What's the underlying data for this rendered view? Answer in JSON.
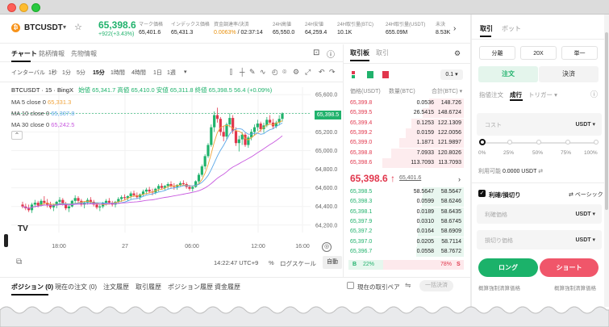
{
  "ticker": {
    "coin_icon": "bitcoin-icon",
    "symbol": "BTCUSDT",
    "price": "65,398.6",
    "change": "+922(+3.43%)",
    "stats": [
      {
        "label": "マーク価格",
        "value": "65,401.6",
        "orange": false
      },
      {
        "label": "インデックス価格",
        "value": "65,431.3",
        "orange": false
      },
      {
        "label": "資金調達率/決済",
        "value": "0.0063%",
        "value2": " / 02:37:14",
        "orange": true
      },
      {
        "label": "24H高値",
        "value": "65,550.0",
        "orange": false
      },
      {
        "label": "24H安値",
        "value": "64,259.4",
        "orange": false
      },
      {
        "label": "24H取引量(BTC)",
        "value": "10.1K",
        "orange": false
      },
      {
        "label": "24H取引量(USDT)",
        "value": "655.09M",
        "orange": false
      },
      {
        "label": "未決",
        "value": "8.53K",
        "orange": false
      }
    ]
  },
  "chart_tabs": [
    "チャート",
    "銘柄情報",
    "先物情報"
  ],
  "chart_toolbar": {
    "intervals": [
      "インターバル",
      "1秒",
      "1分",
      "5分",
      "15分",
      "1時間",
      "4時間",
      "1日",
      "1週"
    ],
    "active_interval": "15分"
  },
  "chart_info": {
    "title": "BTCUSDT · 15 · BingX",
    "ohlc": "始値 65,341.7  高値 65,410.0  安値 65,311.8  終値 65,398.5  56.4 (+0.09%)",
    "ma5_label": "MA 5 close 0",
    "ma5_value": "65,331.3",
    "ma10_label": "MA 10 close 0",
    "ma10_value": "65,307.8",
    "ma30_label": "MA 30 close 0",
    "ma30_value": "65,242.5",
    "last_price_tag": "65,398.5",
    "time_label": "14:22:47 UTC+9",
    "log_scale": "ログスケール",
    "auto": "自動",
    "pct": "%"
  },
  "chart_data": {
    "type": "candlestick",
    "yticks": [
      "65,600.0",
      "65,400.0",
      "65,200.0",
      "65,000.0",
      "64,800.0",
      "64,600.0",
      "64,400.0",
      "64,200.0"
    ],
    "ylim": [
      64120,
      65680
    ],
    "xticks": [
      "18:00",
      "27",
      "06:00",
      "12:00",
      "16:00"
    ],
    "candles": [
      [
        64420,
        64450,
        64380,
        64400
      ],
      [
        64400,
        64430,
        64360,
        64380
      ],
      [
        64380,
        64420,
        64340,
        64360
      ],
      [
        64360,
        64440,
        64330,
        64420
      ],
      [
        64420,
        64470,
        64390,
        64440
      ],
      [
        64440,
        64460,
        64390,
        64410
      ],
      [
        64410,
        64480,
        64400,
        64460
      ],
      [
        64460,
        64510,
        64420,
        64440
      ],
      [
        64440,
        64480,
        64390,
        64420
      ],
      [
        64420,
        64450,
        64370,
        64390
      ],
      [
        64390,
        64430,
        64350,
        64410
      ],
      [
        64410,
        64460,
        64380,
        64450
      ],
      [
        64450,
        64500,
        64420,
        64470
      ],
      [
        64470,
        64490,
        64410,
        64430
      ],
      [
        64430,
        64450,
        64360,
        64380
      ],
      [
        64380,
        64420,
        64340,
        64400
      ],
      [
        64400,
        64470,
        64390,
        64460
      ],
      [
        64460,
        64520,
        64430,
        64490
      ],
      [
        64490,
        64510,
        64440,
        64460
      ],
      [
        64460,
        64480,
        64400,
        64420
      ],
      [
        64420,
        64450,
        64380,
        64440
      ],
      [
        64440,
        64490,
        64420,
        64470
      ],
      [
        64470,
        64500,
        64430,
        64450
      ],
      [
        64450,
        64470,
        64400,
        64420
      ],
      [
        64420,
        64440,
        64370,
        64390
      ],
      [
        64390,
        64420,
        64350,
        64400
      ],
      [
        64400,
        64450,
        64380,
        64440
      ],
      [
        64440,
        64480,
        64410,
        64460
      ],
      [
        64460,
        64490,
        64420,
        64440
      ],
      [
        64440,
        64460,
        64400,
        64420
      ],
      [
        64420,
        64460,
        64390,
        64450
      ],
      [
        64450,
        64500,
        64430,
        64480
      ],
      [
        64480,
        64520,
        64450,
        64500
      ],
      [
        64500,
        64530,
        64470,
        64490
      ],
      [
        64490,
        64520,
        64460,
        64510
      ],
      [
        64510,
        64560,
        64480,
        64540
      ],
      [
        64540,
        64570,
        64500,
        64520
      ],
      [
        64520,
        64550,
        64480,
        64500
      ],
      [
        64500,
        64540,
        64470,
        64530
      ],
      [
        64530,
        64580,
        64510,
        64560
      ],
      [
        64560,
        64600,
        64530,
        64580
      ],
      [
        64580,
        64610,
        64540,
        64560
      ],
      [
        64560,
        64590,
        64520,
        64550
      ],
      [
        64550,
        64600,
        64530,
        64590
      ],
      [
        64590,
        64640,
        64560,
        64620
      ],
      [
        64620,
        64650,
        64580,
        64600
      ],
      [
        64600,
        64630,
        64570,
        64620
      ],
      [
        64620,
        64660,
        64590,
        64640
      ],
      [
        64640,
        64670,
        64600,
        64620
      ],
      [
        64620,
        64650,
        64580,
        64610
      ],
      [
        64610,
        64640,
        64580,
        64630
      ],
      [
        64630,
        64670,
        64610,
        64650
      ],
      [
        64650,
        64680,
        64620,
        64640
      ],
      [
        64640,
        64660,
        64590,
        64610
      ],
      [
        64610,
        64630,
        64570,
        64590
      ],
      [
        64590,
        64620,
        64560,
        64610
      ],
      [
        64610,
        64680,
        64600,
        64670
      ],
      [
        64670,
        64760,
        64650,
        64740
      ],
      [
        64740,
        64850,
        64720,
        64830
      ],
      [
        64830,
        64960,
        64800,
        64940
      ],
      [
        64940,
        65080,
        64920,
        65060
      ],
      [
        65060,
        65280,
        65040,
        65250
      ],
      [
        65250,
        65420,
        65200,
        65380
      ],
      [
        65380,
        65460,
        65300,
        65340
      ],
      [
        65340,
        65360,
        65160,
        65200
      ],
      [
        65200,
        65260,
        65100,
        65150
      ],
      [
        65150,
        65300,
        65120,
        65280
      ],
      [
        65280,
        65400,
        65250,
        65350
      ],
      [
        65350,
        65380,
        65180,
        65210
      ],
      [
        65210,
        65250,
        65050,
        65080
      ],
      [
        65080,
        65160,
        64990,
        65120
      ],
      [
        65120,
        65200,
        65060,
        65170
      ],
      [
        65170,
        65190,
        65040,
        65060
      ],
      [
        65060,
        65160,
        65030,
        65140
      ],
      [
        65140,
        65230,
        65110,
        65200
      ],
      [
        65200,
        65280,
        65160,
        65250
      ],
      [
        65250,
        65330,
        65210,
        65290
      ],
      [
        65290,
        65310,
        65200,
        65230
      ],
      [
        65230,
        65300,
        65190,
        65270
      ],
      [
        65270,
        65360,
        65250,
        65330
      ],
      [
        65330,
        65380,
        65280,
        65300
      ],
      [
        65300,
        65340,
        65230,
        65260
      ],
      [
        65260,
        65320,
        65240,
        65300
      ],
      [
        65300,
        65380,
        65270,
        65340
      ],
      [
        65340,
        65410,
        65310,
        65398
      ]
    ],
    "ma": [
      {
        "name": "MA 5",
        "color": "#f0a33a"
      },
      {
        "name": "MA 10",
        "color": "#5aa7e8"
      },
      {
        "name": "MA 30",
        "color": "#c85adf"
      }
    ]
  },
  "orderbook": {
    "tabs": [
      "取引板",
      "取引"
    ],
    "precision": "0.1",
    "headers": [
      "価格(USDT)",
      "数量(BTC)",
      "合計(BTC)"
    ],
    "asks": [
      [
        "65,399.8",
        "0.0536",
        "148.726",
        0.3
      ],
      [
        "65,399.5",
        "26.5415",
        "148.6724",
        0.35
      ],
      [
        "65,399.4",
        "0.1253",
        "122.1309",
        0.45
      ],
      [
        "65,399.2",
        "0.0159",
        "122.0056",
        0.5
      ],
      [
        "65,399.0",
        "1.1871",
        "121.9897",
        0.55
      ],
      [
        "65,398.8",
        "7.0933",
        "120.8026",
        0.62
      ],
      [
        "65,398.6",
        "113.7093",
        "113.7093",
        0.7
      ]
    ],
    "mid_price": "65,398.6 ↑",
    "mark": "65,401.6",
    "bids": [
      [
        "65,398.5",
        "58.5647",
        "58.5647",
        0.35
      ],
      [
        "65,398.3",
        "0.0599",
        "58.6246",
        0.36
      ],
      [
        "65,398.1",
        "0.0189",
        "58.6435",
        0.37
      ],
      [
        "65,397.9",
        "0.0310",
        "58.6745",
        0.38
      ],
      [
        "65,397.2",
        "0.0164",
        "58.6909",
        0.39
      ],
      [
        "65,397.0",
        "0.0205",
        "58.7114",
        0.4
      ],
      [
        "65,396.7",
        "0.0558",
        "58.7672",
        0.41
      ]
    ],
    "ratio_b": "B",
    "ratio_b_pct": "22%",
    "ratio_s_pct": "78%",
    "ratio_s": "S"
  },
  "bottom_tabs": [
    "ポジション (0)",
    "現在の注文 (0)",
    "注文履歴",
    "取引履歴",
    "ポジション履歴",
    "資金履歴"
  ],
  "bottom_right": {
    "checkbox_label": "現在の取引ペア",
    "close_all": "一括決済"
  },
  "panel": {
    "tabs": [
      "取引",
      "ボット"
    ],
    "margin_mode": "分離",
    "leverage": "20X",
    "position_mode": "単一",
    "open": "注文",
    "close": "決済",
    "order_types": [
      "指値注文",
      "成行",
      "トリガー"
    ],
    "active_order_type": "成行",
    "cost_label": "コスト",
    "cost_unit": "USDT",
    "percents": [
      "0%",
      "25%",
      "50%",
      "75%",
      "100%"
    ],
    "available_label": "利用可能",
    "available_value": "0.0000 USDT",
    "tpsl_label": "利確/損切り",
    "basic": "ベーシック",
    "tp_label": "利確価格",
    "sl_label": "損切り価格",
    "unit_usdt": "USDT",
    "long": "ロング",
    "short": "ショート",
    "est_long": "概算強制清算価格",
    "est_short": "概算強制清算価格"
  }
}
